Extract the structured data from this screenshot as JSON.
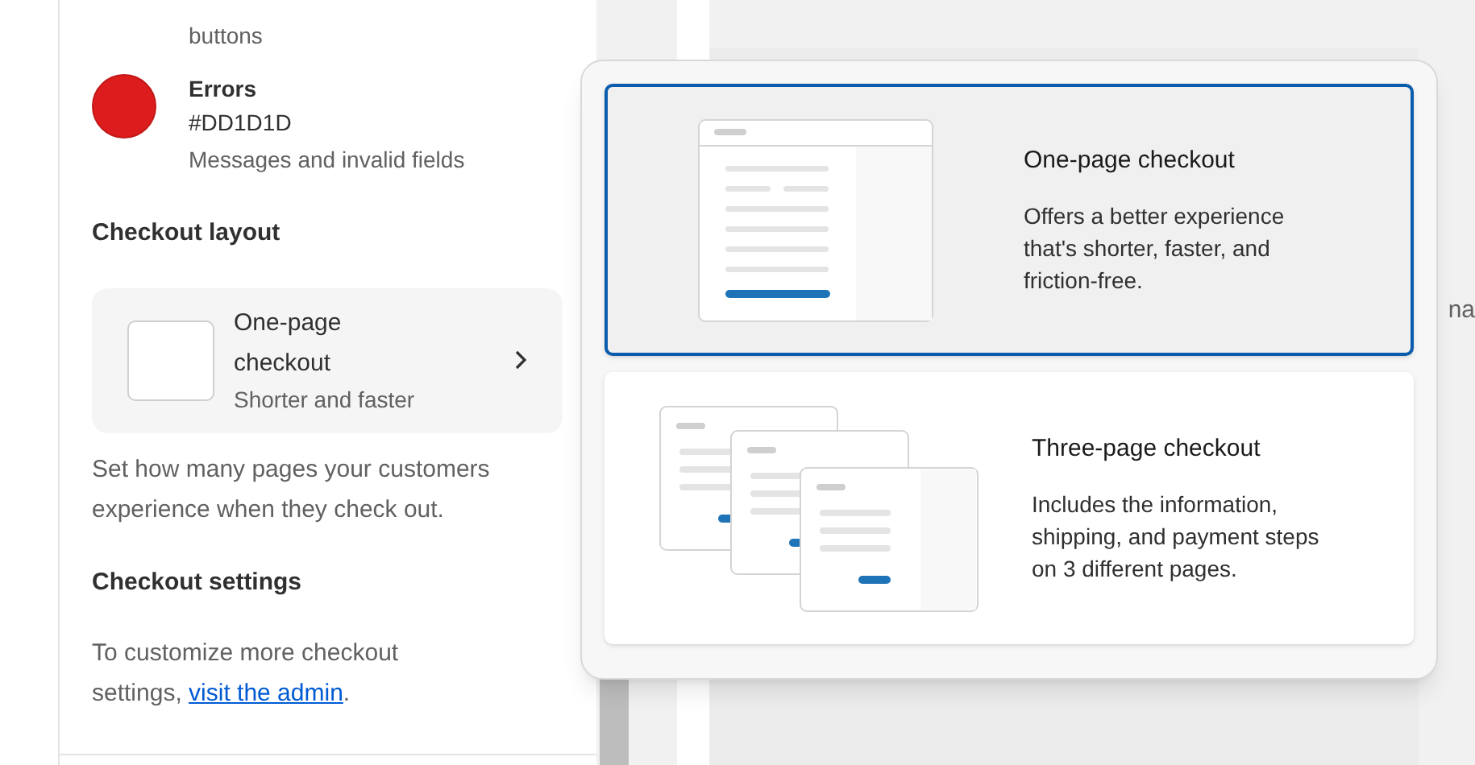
{
  "sidebar": {
    "cut_text": "buttons",
    "colors": [
      {
        "name": "Errors",
        "value": "#DD1D1D",
        "description": "Messages and invalid fields",
        "color": "#dd1d1d"
      }
    ],
    "layout_heading": "Checkout layout",
    "layout_card": {
      "title": "One-page checkout",
      "subtitle": "Shorter and faster"
    },
    "layout_help": "Set how many pages your customers experience when they check out.",
    "settings_heading": "Checkout settings",
    "settings_text": "To customize more checkout settings, ",
    "settings_link": "visit the admin",
    "settings_end": "."
  },
  "background_text": "na",
  "layout_options": [
    {
      "kind": "one-page",
      "title": "One-page checkout",
      "description": "Offers a better experience that's shorter, faster, and friction-free.",
      "selected": true
    },
    {
      "kind": "three-page",
      "title": "Three-page checkout",
      "description": "Includes the information, shipping, and payment steps on 3 different pages.",
      "selected": false
    }
  ]
}
